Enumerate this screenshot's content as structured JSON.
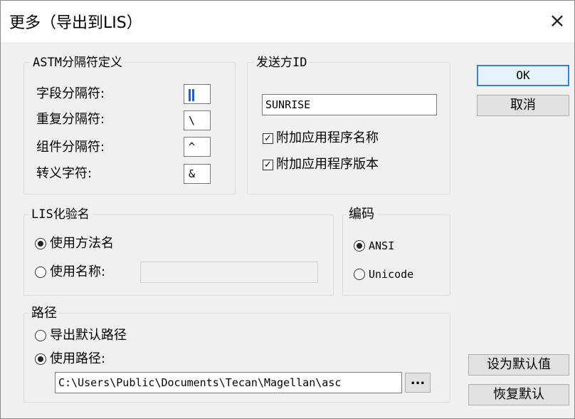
{
  "window": {
    "title": "更多（导出到LIS）",
    "close_glyph": "×"
  },
  "astm": {
    "legend": "ASTM分隔符定义",
    "field_sep_label": "字段分隔符:",
    "field_sep_value": "",
    "repeat_sep_label": "重复分隔符:",
    "repeat_sep_value": "\\",
    "component_sep_label": "组件分隔符:",
    "component_sep_value": "^",
    "escape_label": "转义字符:",
    "escape_value": "&"
  },
  "sender": {
    "legend": "发送方ID",
    "id_value": "SUNRISE",
    "check_app_name_label": "附加应用程序名称",
    "check_app_name_checked": true,
    "check_app_version_label": "附加应用程序版本",
    "check_app_version_checked": true
  },
  "lis_name": {
    "legend": "LIS化验名",
    "use_method_label": "使用方法名",
    "use_method_checked": true,
    "use_name_label": "使用名称:",
    "use_name_checked": false,
    "use_name_value": ""
  },
  "encoding": {
    "legend": "编码",
    "ansi_label": "ANSI",
    "ansi_checked": true,
    "unicode_label": "Unicode",
    "unicode_checked": false
  },
  "path": {
    "legend": "路径",
    "export_default_label": "导出默认路径",
    "export_default_checked": false,
    "use_path_label": "使用路径:",
    "use_path_checked": true,
    "path_value": "C:\\Users\\Public\\Documents\\Tecan\\Magellan\\asc",
    "browse_label": "..."
  },
  "buttons": {
    "ok": "OK",
    "cancel": "取消",
    "set_default": "设为默认值",
    "restore_default": "恢复默认"
  },
  "colors": {
    "accent": "#3c7fd9",
    "dialog_bg": "#f0f0f0"
  }
}
